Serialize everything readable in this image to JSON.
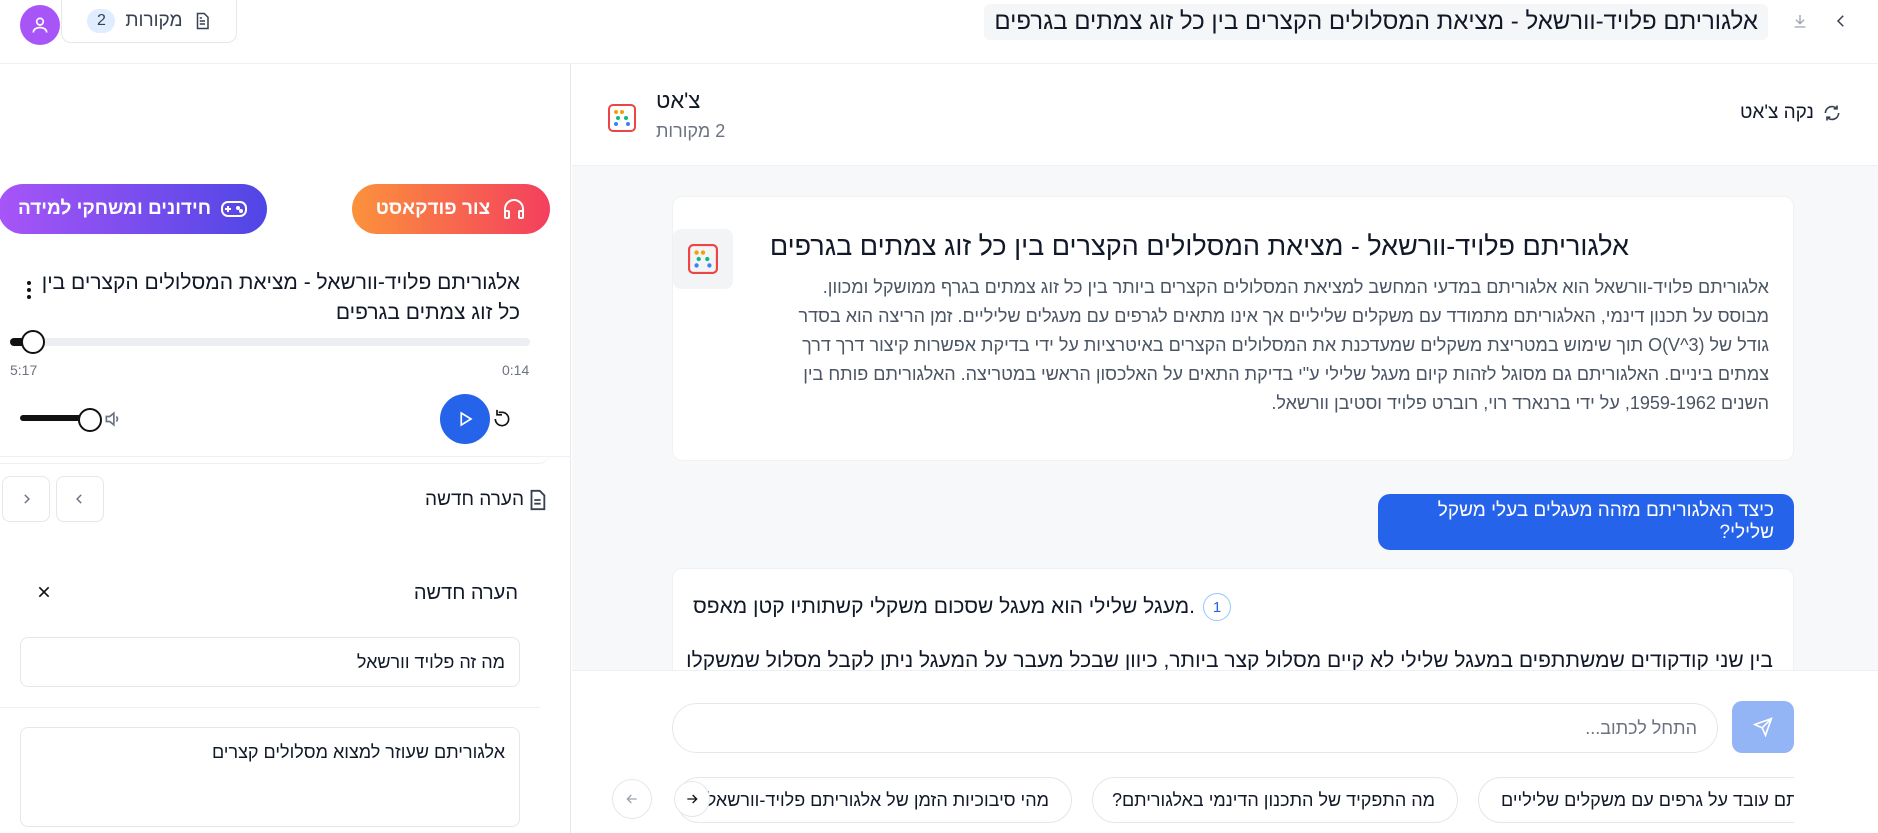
{
  "top": {
    "title": "אלגוריתם פלויד-וורשאל - מציאת המסלולים הקצרים בין כל זוג צמתים בגרפים",
    "sources_label": "מקורות",
    "sources_count": "2"
  },
  "left": {
    "games_label": "חידונים ומשחקי למידה",
    "podcast_label": "צור פודקאסט",
    "player": {
      "title": "אלגוריתם פלויד-וורשאל - מציאת המסלולים הקצרים בין כל זוג צמתים בגרפים",
      "elapsed": "0:14",
      "total": "5:17",
      "progress_fraction": 0.044,
      "volume_fraction": 1.0
    },
    "new_note_label": "הערה חדשה",
    "note_form": {
      "title": "הערה חדשה",
      "title_value": "מה זה פלויד וורשאל",
      "body_value": "אלגוריתם שעוזר למצוא מסלולים קצרים"
    }
  },
  "chat": {
    "title": "צ'אט",
    "sources_sub": "2 מקורות",
    "clear_label": "נקה צ'אט",
    "summary": {
      "title": "אלגוריתם פלויד-וורשאל - מציאת המסלולים הקצרים בין כל זוג צמתים בגרפים",
      "body": "אלגוריתם פלויד-וורשאל הוא אלגוריתם במדעי המחשב למציאת המסלולים הקצרים ביותר בין כל זוג צמתים בגרף ממושקל ומכוון. מבוסס על תכנון דינמי, האלגוריתם מתמודד עם משקלים שליליים אך אינו מתאים לגרפים עם מעגלים שליליים. זמן הריצה הוא בסדר גודל של O(V^3) תוך שימוש במטריצת משקלים שמעדכנת את המסלולים הקצרים באיטרציות על ידי בדיקת אפשרות קיצור דרך דרך צמתים ביניים. האלגוריתם גם מסוגל לזהות קיום מעגל שלילי ע\"י בדיקת התאים על האלכסון הראשי במטריצה. האלגוריתם פותח בין השנים 1959-1962, על ידי ברנארד רוי, רוברט פלויד וסטיבן וורשאל."
    },
    "user_question": "כיצד האלגוריתם מזהה מעגלים בעלי משקל שלילי?",
    "answer": {
      "line1": "מעגל שלילי הוא מעגל שסכום משקלי קשתותיו קטן מאפס.",
      "citation": "1",
      "line2": "בין שני קודקודים שמשתתפים במעגל שלילי לא קיים מסלול קצר ביותר, כיוון שבכל מעבר על המעגל ניתן לקבל מסלול שמשקלו"
    },
    "input_placeholder": "התחל לכתוב...",
    "suggestions": [
      "מהי סיבוכיות הזמן של אלגוריתם פלויד-וורשאל?",
      "מה התפקיד של התכנון הדינמי באלגוריתם?",
      "האם האלגוריתם עובד על גרפים עם משקלים שליליים"
    ]
  },
  "colors": {
    "accent_blue": "#2563eb",
    "avatar_purple": "#a855f7",
    "podcast_gradient": [
      "#fb923c",
      "#f43f5e"
    ],
    "games_gradient": [
      "#a855f7",
      "#4f46e5"
    ]
  }
}
